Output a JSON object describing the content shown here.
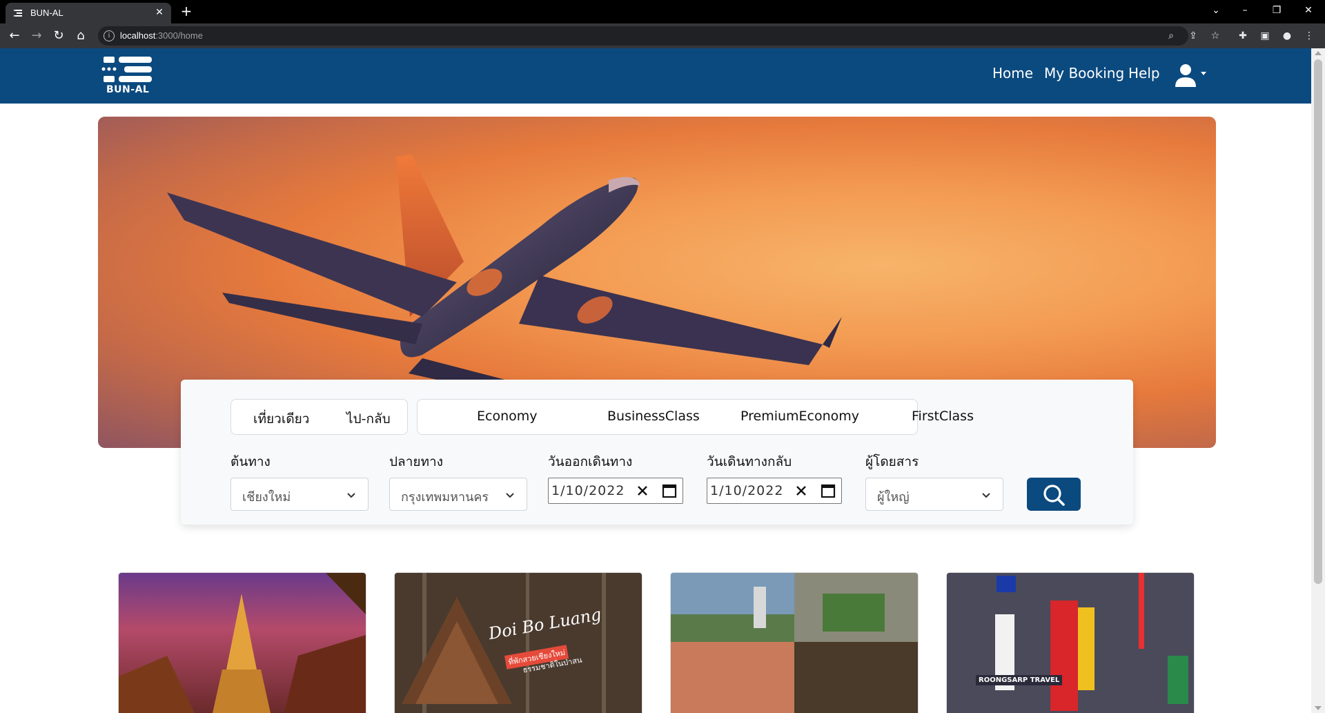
{
  "browser": {
    "tab_title": "BUN-AL",
    "url_host": "localhost",
    "url_path": ":3000/home"
  },
  "header": {
    "logo_text": "BUN-AL",
    "nav": [
      {
        "label": "Home"
      },
      {
        "label": "My Booking"
      },
      {
        "label": "Help"
      }
    ]
  },
  "search": {
    "trip_types": [
      "เที่ยวเดียว",
      "ไป-กลับ"
    ],
    "classes": [
      "Economy",
      "BusinessClass",
      "PremiumEconomy",
      "FirstClass"
    ],
    "origin_label": "ต้นทาง",
    "origin_value": "เชียงใหม่",
    "destination_label": "ปลายทาง",
    "destination_value": "กรุงเทพมหานคร",
    "depart_label": "วันออกเดินทาง",
    "depart_value": "1/10/2022",
    "return_label": "วันเดินทางกลับ",
    "return_value": "1/10/2022",
    "passenger_label": "ผู้โดยสาร",
    "passenger_value": "ผู้ใหญ่"
  },
  "cards": [
    {
      "image_text": ""
    },
    {
      "image_text": "Doi Bo Luang",
      "image_subtext_1": "ที่พักสวยเชียงใหม่",
      "image_subtext_2": "ธรรมชาติในป่าสน"
    },
    {
      "image_text": ""
    },
    {
      "image_text": "ROONGSARP TRAVEL"
    }
  ],
  "colors": {
    "brand": "#0b4a7f",
    "hero_sky": "#f39a52"
  }
}
